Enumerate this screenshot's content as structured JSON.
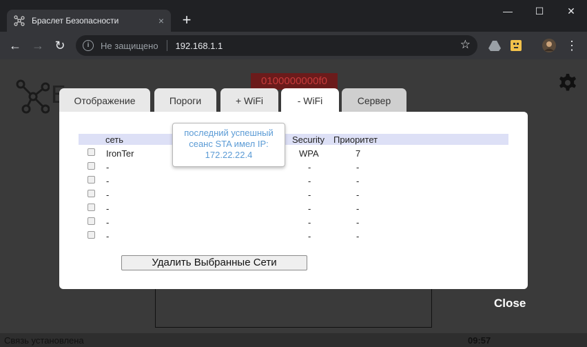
{
  "browser": {
    "tab_title": "Браслет Безопасности",
    "tab_close": "×",
    "new_tab": "+",
    "window_controls": {
      "minimize": "—",
      "maximize": "☐",
      "close": "✕"
    },
    "nav": {
      "back": "←",
      "forward": "→",
      "reload": "↻"
    },
    "security_label": "Не защищено",
    "url": "192.168.1.1",
    "bookmark_icon": "star-icon"
  },
  "page": {
    "logo_letter": "Б",
    "device_id": "0100000000f0",
    "close_label": "Close",
    "status": "Связь установлена",
    "time": "09:57"
  },
  "tabs": [
    {
      "label": "Отображение"
    },
    {
      "label": "Пороги"
    },
    {
      "label": "+ WiFi"
    },
    {
      "label": "- WiFi"
    },
    {
      "label": "Сервер"
    }
  ],
  "table": {
    "headers": {
      "network": "сеть",
      "security": "Security",
      "priority": "Приоритет"
    },
    "rows": [
      {
        "name": "IronTer",
        "security": "WPA",
        "priority": "7"
      },
      {
        "name": "-",
        "security": "-",
        "priority": "-"
      },
      {
        "name": "-",
        "security": "-",
        "priority": "-"
      },
      {
        "name": "-",
        "security": "-",
        "priority": "-"
      },
      {
        "name": "-",
        "security": "-",
        "priority": "-"
      },
      {
        "name": "-",
        "security": "-",
        "priority": "-"
      },
      {
        "name": "-",
        "security": "-",
        "priority": "-"
      }
    ]
  },
  "tooltip": {
    "line1": "последний успешный",
    "line2": "сеанс STA имел IP:",
    "line3": "172.22.22.4"
  },
  "delete_button": "Удалить Выбранные Сети",
  "colors": {
    "accent_tooltip": "#5b9bd5",
    "header_row": "#dde0f6",
    "device_id_bg": "#6b1b1b"
  }
}
